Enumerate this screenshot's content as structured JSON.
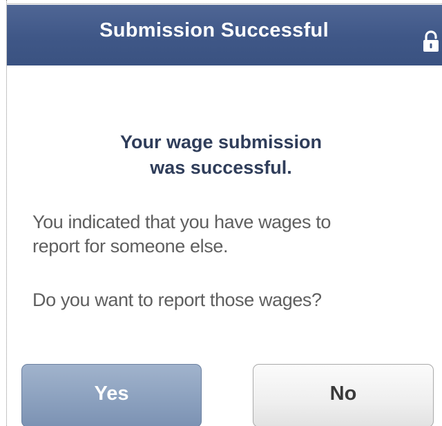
{
  "dialog": {
    "title": "Submission Successful",
    "lock_icon": "lock-icon",
    "heading_line1": "Your wage submission",
    "heading_line2": "was successful.",
    "info_text_line1": "You indicated that you have wages to",
    "info_text_line2": "report for someone else.",
    "question_text": "Do you want to report those wages?",
    "yes_label": "Yes",
    "no_label": "No"
  },
  "colors": {
    "header_background": "#3f5787",
    "heading_text": "#2f3d5a",
    "body_text": "#5f5f5f",
    "yes_button": "#8ea3c0",
    "no_button": "#efefef"
  }
}
